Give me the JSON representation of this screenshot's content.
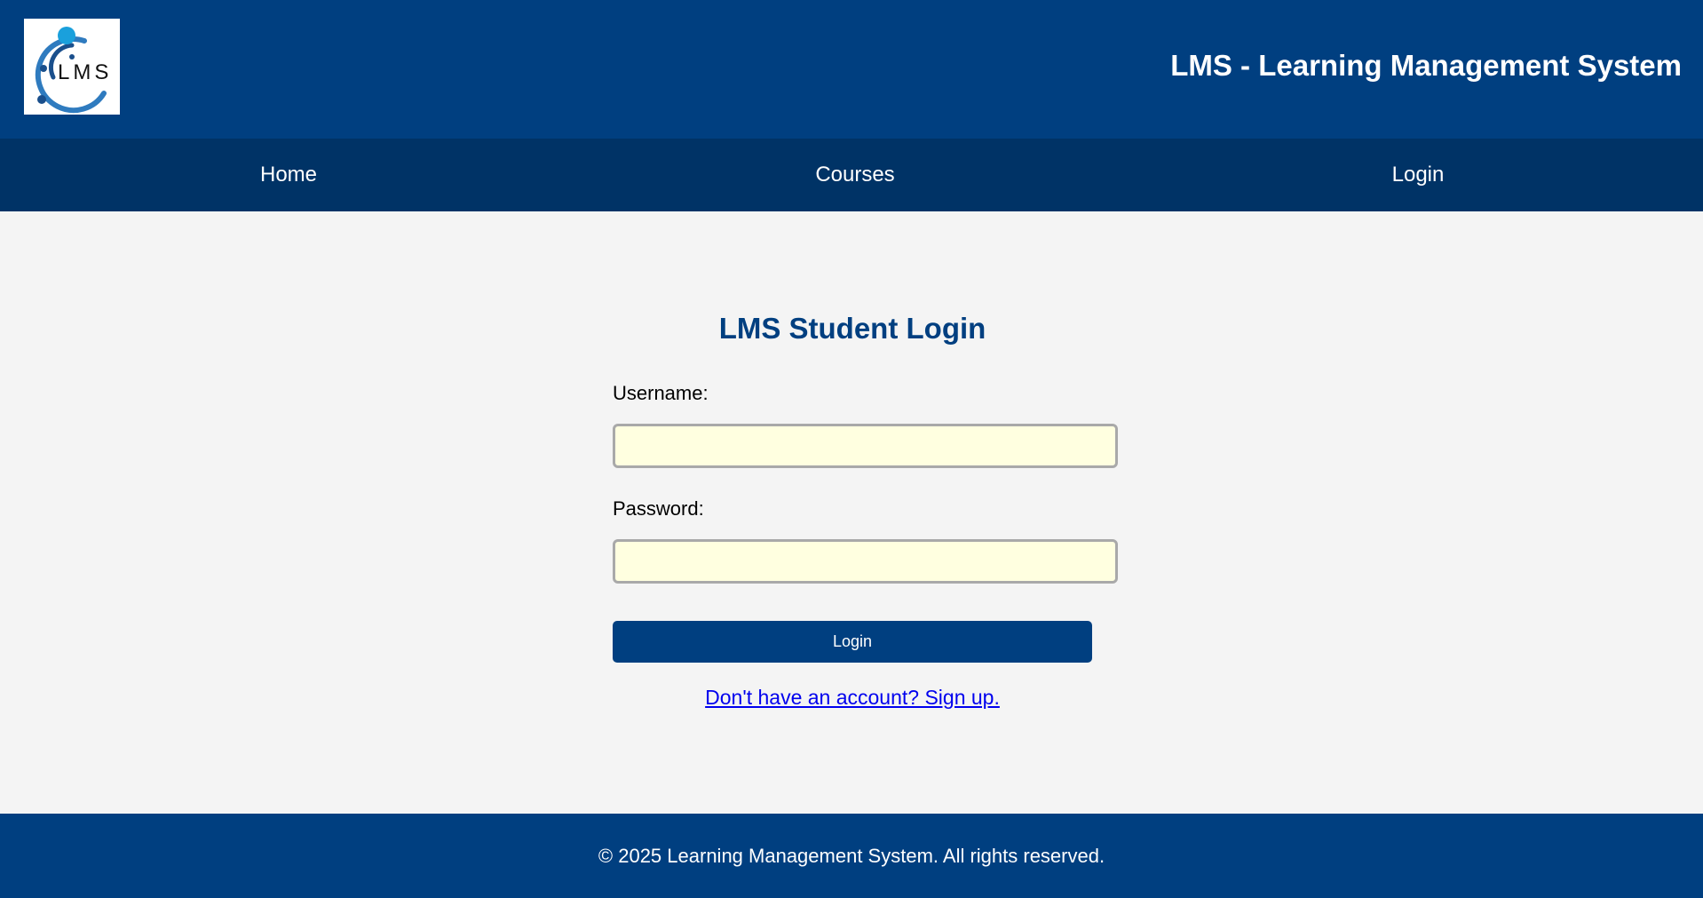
{
  "header": {
    "logo_text": "LMS",
    "title": "LMS - Learning Management System"
  },
  "nav": {
    "items": [
      {
        "label": "Home"
      },
      {
        "label": "Courses"
      },
      {
        "label": "Login"
      }
    ]
  },
  "login_form": {
    "title": "LMS Student Login",
    "username_label": "Username:",
    "username_value": "",
    "password_label": "Password:",
    "password_value": "",
    "submit_label": "Login",
    "signup_link": "Don't have an account? Sign up."
  },
  "footer": {
    "text": "© 2025 Learning Management System. All rights reserved."
  },
  "colors": {
    "header_bg": "#003f80",
    "nav_bg": "#003366",
    "page_bg": "#f4f4f4",
    "input_bg": "#ffffe0",
    "link": "#0000ee"
  }
}
